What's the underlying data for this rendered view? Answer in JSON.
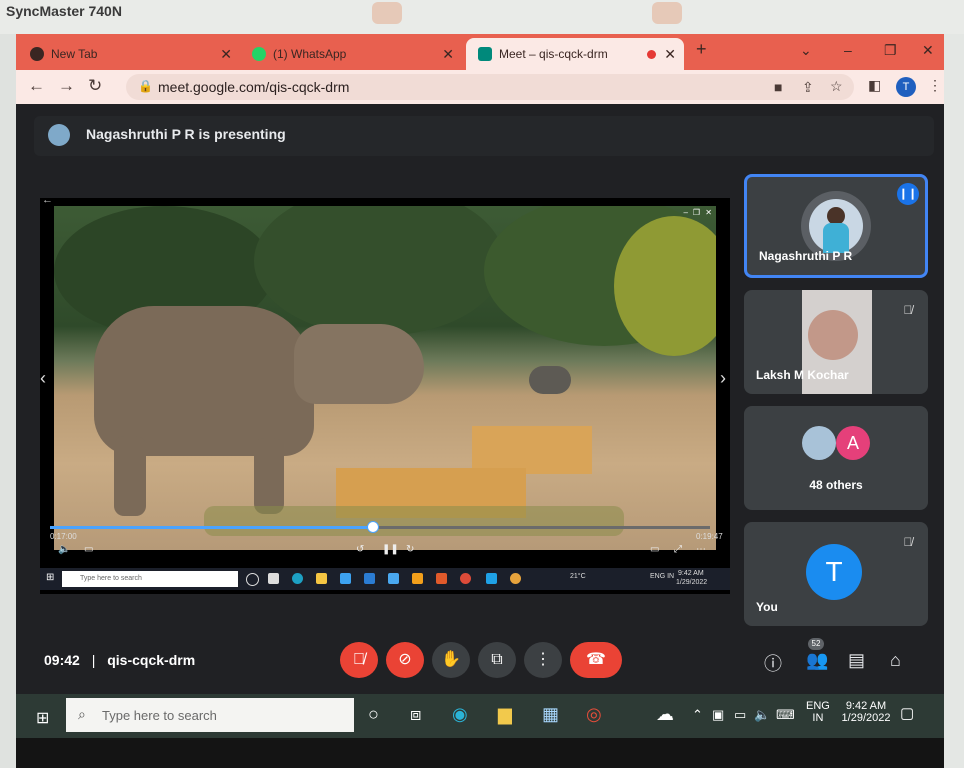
{
  "monitor": {
    "brand": "SyncMaster 740N"
  },
  "browser": {
    "tabs": [
      {
        "title": "New Tab",
        "color": "#3a2622"
      },
      {
        "title": "(1) WhatsApp",
        "color": "#25d366"
      },
      {
        "title": "Meet – qis-cqck-drm",
        "color": "#e53935"
      }
    ],
    "new_tab": "+",
    "window_controls": {
      "dropdown": "⌄",
      "minimize": "–",
      "restore": "❐",
      "close": "✕"
    },
    "nav": {
      "back": "←",
      "forward": "→",
      "reload": "↻"
    },
    "url": "meet.google.com/qis-cqck-drm",
    "profile_initial": "T"
  },
  "meet": {
    "presenting_text": "Nagashruthi P R is presenting",
    "video": {
      "time_current": "0:17:00",
      "time_total": "0:19:47",
      "progress_fraction": 0.49
    },
    "participants": [
      {
        "name": "Nagashruthi P R",
        "state": "speaking"
      },
      {
        "name": "Laksh M Kochar",
        "state": "muted"
      },
      {
        "name": "48 others",
        "avatar_letter": "A"
      },
      {
        "name": "You",
        "avatar_letter": "T",
        "state": "muted"
      }
    ],
    "clock": "09:42",
    "separator": "|",
    "meeting_code": "qis-cqck-drm",
    "people_count": "52",
    "colors": {
      "accent_blue": "#4285f4",
      "danger_red": "#ea4335",
      "button_gray": "#3c4043"
    }
  },
  "inner_taskbar": {
    "search_placeholder": "Type here to search",
    "weather": "21°C",
    "lang": "ENG IN",
    "time": "9:42 AM",
    "date": "1/29/2022"
  },
  "taskbar": {
    "search_placeholder": "Type here to search",
    "lang_top": "ENG",
    "lang_bottom": "IN",
    "time": "9:42 AM",
    "date": "1/29/2022"
  }
}
